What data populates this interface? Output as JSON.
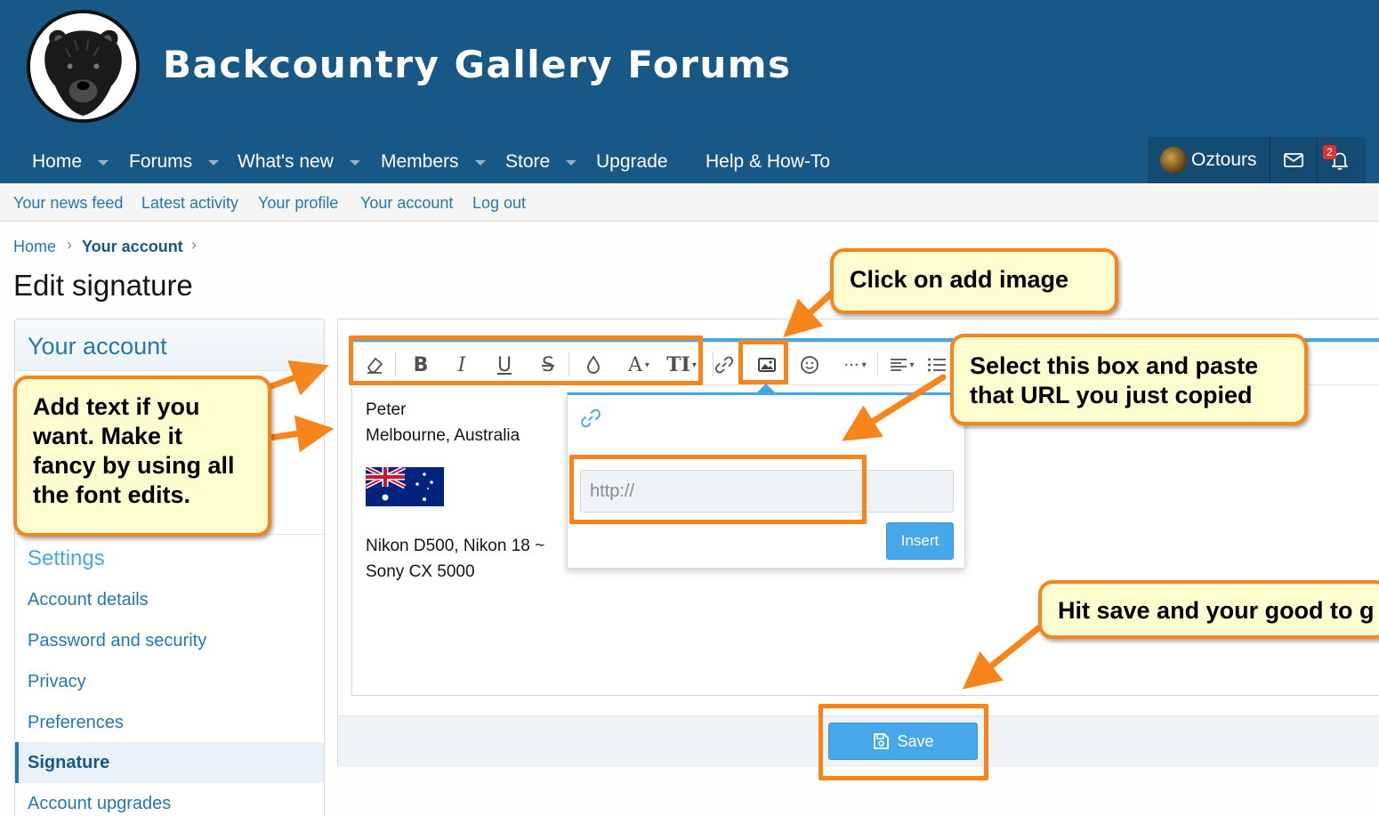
{
  "header": {
    "site_title": "Backcountry Gallery Forums",
    "nav": [
      {
        "label": "Home"
      },
      {
        "label": "Forums"
      },
      {
        "label": "What's new"
      },
      {
        "label": "Members"
      },
      {
        "label": "Store"
      },
      {
        "label": "Upgrade"
      },
      {
        "label": "Help & How-To"
      }
    ],
    "user": {
      "name": "Oztours",
      "alert_count": "2"
    }
  },
  "subnav": [
    "Your news feed",
    "Latest activity",
    "Your profile",
    "Your account",
    "Log out"
  ],
  "breadcrumb": {
    "home": "Home",
    "current": "Your account",
    "separator": "›"
  },
  "page_title": "Edit signature",
  "sidebar": {
    "title": "Your account",
    "settings_heading": "Settings",
    "links": [
      "Account details",
      "Password and security",
      "Privacy",
      "Preferences",
      "Signature",
      "Account upgrades"
    ],
    "active": "Signature"
  },
  "editor": {
    "toolbar": [
      "eraser-icon",
      "bold-icon",
      "italic-icon",
      "underline-icon",
      "strikethrough-icon",
      "color-icon",
      "font-family-icon",
      "font-size-icon",
      "link-icon",
      "image-icon",
      "smiley-icon",
      "more-icon",
      "align-icon",
      "list-icon"
    ],
    "toolbar_glyphs": {
      "bold": "B",
      "italic": "I",
      "underline": "U",
      "strike": "S",
      "font": "A",
      "size": "TI",
      "more": "···"
    },
    "content": [
      "Peter",
      "Melbourne, Australia",
      "Nikon D500, Nikon 18 ~",
      "Sony CX 5000"
    ]
  },
  "image_popup": {
    "url_placeholder": "http://",
    "insert_label": "Insert"
  },
  "save_label": "Save",
  "annotations": {
    "click_add_image": "Click on add image",
    "add_text": [
      "Add text if you",
      "want. Make it",
      "fancy by using all",
      "the font edits."
    ],
    "paste_url": [
      "Select this box and paste",
      "that URL you just copied"
    ],
    "hit_save": "Hit save and your good to g"
  },
  "colors": {
    "header_bg": "#185886",
    "link": "#2577b1",
    "button": "#47a7eb",
    "highlight_orange": "#f7851c",
    "callout_bg": "#fdfdd0"
  }
}
